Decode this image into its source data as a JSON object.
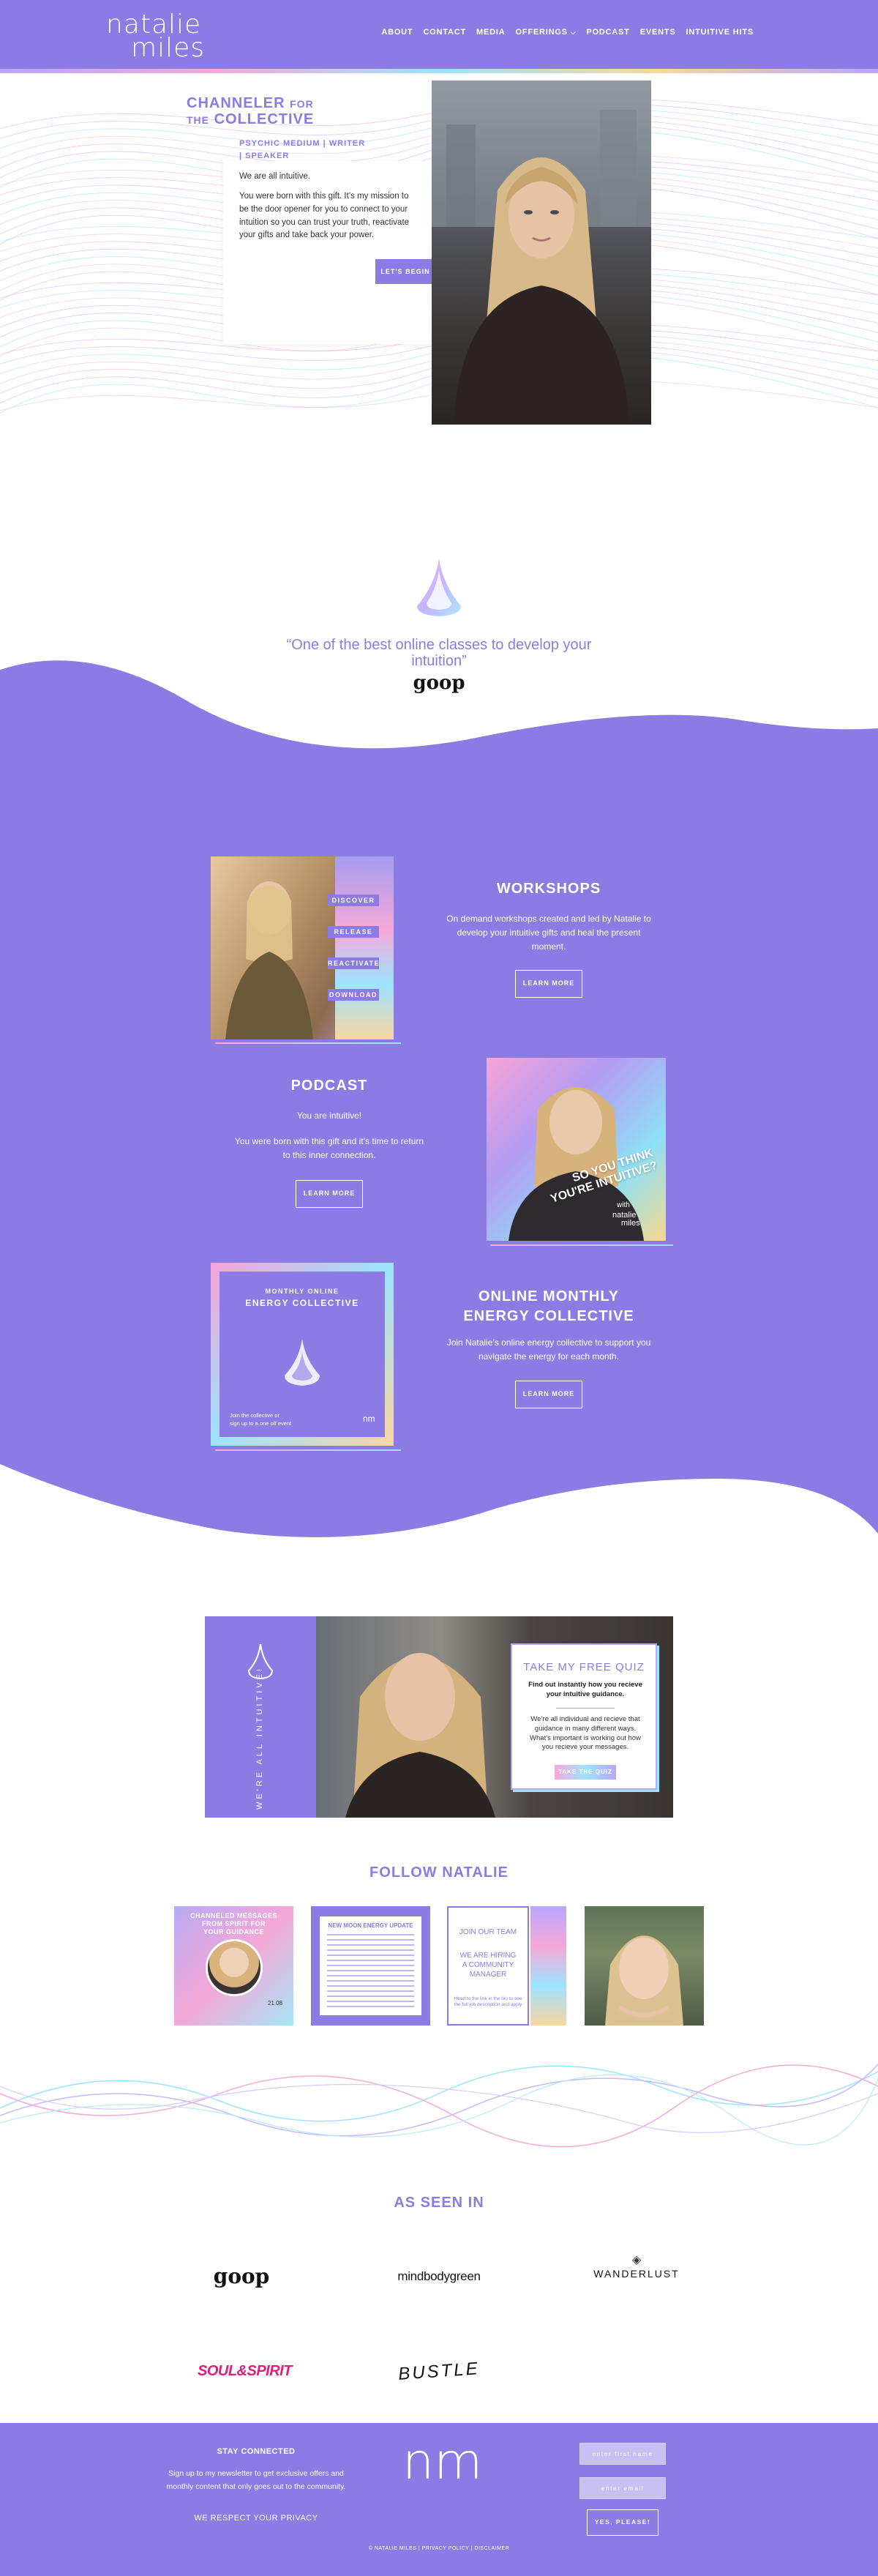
{
  "header": {
    "logo_line1": "natalie",
    "logo_line2": "miles",
    "nav": [
      "ABOUT",
      "CONTACT",
      "MEDIA",
      "OFFERINGS",
      "PODCAST",
      "EVENTS",
      "INTUITIVE HITS"
    ],
    "offerings_chevron": "chevron-down-icon"
  },
  "hero": {
    "title_line1_a": "CHANNELER",
    "title_line1_b": "FOR",
    "title_line2_a": "THE",
    "title_line2_b": "COLLECTIVE",
    "subtitle_line1": "PSYCHIC MEDIUM | WRITER",
    "subtitle_line2": "| SPEAKER",
    "text1": "We are all intuitive.",
    "text2": "You were born with this gift. It’s my mission to be the door opener for you to connect to your intuition so you can trust your truth, reactivate your gifts and take back your power.",
    "button": "LET'S BEGIN"
  },
  "quote": {
    "text": "“One of the best online classes to develop your intuition”",
    "source": "goop"
  },
  "workshops": {
    "title": "WORKSHOPS",
    "text": "On demand workshops created and led by Natalie to develop your intuitive gifts and heal the present moment.",
    "button": "LEARN MORE",
    "tags": [
      "DISCOVER",
      "RELEASE",
      "REACTIVATE",
      "DOWNLOAD"
    ]
  },
  "podcast": {
    "title": "PODCAST",
    "text1": "You are intuitive!",
    "text2": "You were born with this gift and it’s time to return to this inner connection.",
    "button": "LEARN MORE",
    "cover_text1": "SO YOU THINK",
    "cover_text2": "YOU'RE INTUITIVE?",
    "cover_with": "with",
    "cover_brand1": "natalie",
    "cover_brand2": "miles"
  },
  "collective": {
    "title_line1": "ONLINE MONTHLY",
    "title_line2": "ENERGY COLLECTIVE",
    "text": "Join Natalie’s online energy collective to support you navigate the energy for each month.",
    "button": "LEARN MORE",
    "card_line1": "MONTHLY ONLINE",
    "card_line2": "ENERGY COLLECTIVE",
    "card_foot1": "Join the collective or",
    "card_foot2": "sign up to a one off event",
    "card_mark": "nm"
  },
  "quiz": {
    "side_text": "WE'RE ALL INTUITIVE!",
    "title": "TAKE MY FREE QUIZ",
    "sub": "Find out instantly how you recieve your intuitive guidance.",
    "desc": "We’re all individual and recieve that guidance in many different ways. What’s important is working out how you recieve your messages.",
    "button": "TAKE THE QUIZ"
  },
  "follow": {
    "title": "FOLLOW NATALIE",
    "tile1_line1": "CHANNELED MESSAGES",
    "tile1_line2": "FROM SPIRIT FOR",
    "tile1_line3": "YOUR GUIDANCE",
    "tile1_date": "21.08",
    "tile2_title": "NEW MOON ENERGY UPDATE",
    "tile3_line1": "JOIN OUR TEAM",
    "tile3_line2": "WE ARE HIRING",
    "tile3_line3": "A COMMUNITY",
    "tile3_line4": "MANAGER",
    "tile3_foot": "Head to the link in the bio to see the full job description and apply"
  },
  "seen_in": {
    "title": "AS SEEN IN",
    "brands": [
      "goop",
      "mindbodygreen",
      "WANDERLUST",
      "SOUL&SPIRIT",
      "BUSTLE",
      ""
    ]
  },
  "footer": {
    "heading": "STAY CONNECTED",
    "text": "Sign up to my newsletter to get exclusive offers and monthly content that only goes out to the community.",
    "privacy": "WE RESPECT YOUR PRIVACY",
    "first_name_placeholder": "enter first name",
    "email_placeholder": "enter email",
    "button": "YES, PLEASE!",
    "logo": "nm",
    "copyright": "© NATALIE MILES | PRIVACY POLICY | DISCLAIMER"
  },
  "colors": {
    "primary": "#8b7be3",
    "white": "#ffffff",
    "pink": "#f6a8d8",
    "cyan": "#9de3ff"
  }
}
